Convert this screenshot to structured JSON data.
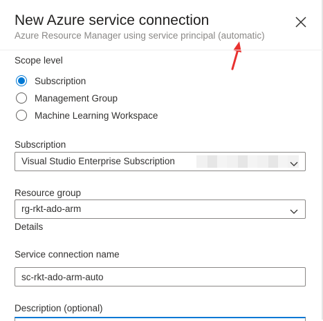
{
  "dialog": {
    "title": "New Azure service connection",
    "subtitle": "Azure Resource Manager using service principal (automatic)",
    "close_icon": "close-icon",
    "annotation_icon": "red-arrow-icon"
  },
  "scope": {
    "label": "Scope level",
    "options": [
      {
        "label": "Subscription",
        "checked": true
      },
      {
        "label": "Management Group",
        "checked": false
      },
      {
        "label": "Machine Learning Workspace",
        "checked": false
      }
    ]
  },
  "subscription": {
    "label": "Subscription",
    "value": "Visual Studio Enterprise Subscription"
  },
  "resource_group": {
    "label": "Resource group",
    "value": "rg-rkt-ado-arm"
  },
  "details": {
    "label": "Details"
  },
  "service_connection": {
    "label": "Service connection name",
    "value": "sc-rkt-ado-arm-auto"
  },
  "description": {
    "label": "Description (optional)"
  },
  "colors": {
    "accent": "#0078d4",
    "annotation": "#e8312f",
    "border": "#8a8886"
  }
}
